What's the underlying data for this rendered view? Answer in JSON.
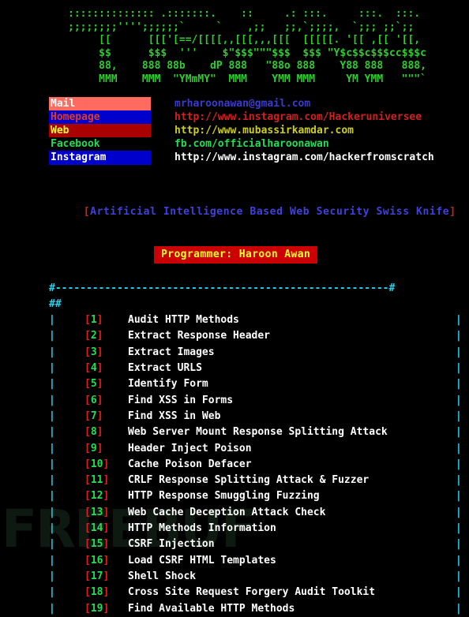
{
  "terminal": {
    "background": "#000000",
    "banner_color": "#2ecc2e",
    "border_color": "#22d3ee",
    "index_color": "#22dd55",
    "bracket_color": "#e02020"
  },
  "watermark": {
    "text": "FREEBUF"
  },
  "banner": {
    "lines": [
      ":::::::::::::: .:::::::.    ::     .: :::.     :::.  :::.",
      ";;;;;;;;'''';;;;;;`     `    ,;;   ;;,`;;;;,  `;;; ;;`;;",
      "     [[      [[['[==/[[[[,,[[[,,,[[[  [[[[[. '[[ ,[[ '[[,",
      "     $$      $$$  '''    $\"$$$\"\"\"$$$  $$$ \"Y$c$$c$$$cc$$$c",
      "     88,    888 88b    dP 888   \"88o 888    Y88 888   888,",
      "     MMM    MMM  \"YMmMY\"  MMM    YMM MMM     YM YMM   \"\"\"`"
    ]
  },
  "contacts": [
    {
      "label": "Mail",
      "value": "mrharoonawan@gmail.com",
      "label_bg": "#ff6b5e",
      "label_fg": "#ffffff",
      "value_fg": "#3a3ad0"
    },
    {
      "label": "Homepage",
      "value": "http://www.instagram.com/Hackeruniversee",
      "label_bg": "#0000cc",
      "label_fg": "#e03a2a",
      "value_fg": "#d02020"
    },
    {
      "label": "Web",
      "value": "http://www.mubassirkamdar.com",
      "label_bg": "#aa0000",
      "label_fg": "#ffff33",
      "value_fg": "#cccc22"
    },
    {
      "label": "Facebook",
      "value": "fb.com/officialharoonawan",
      "label_bg": "#000000",
      "label_fg": "#22dd55",
      "value_fg": "#22dd55"
    },
    {
      "label": "Instagram",
      "value": "http://www.instagram.com/hackerfromscratch",
      "label_bg": "#0000cc",
      "label_fg": "#ffffff",
      "value_fg": "#ffffff"
    }
  ],
  "tagline": {
    "open_bracket": "[",
    "text": "Artificial Intelligence Based Web Security Swiss Knife",
    "close_bracket": "]"
  },
  "programmer": {
    "text": "Programmer: Haroon Awan",
    "bg": "#cc0000",
    "fg": "#ffff33"
  },
  "menu": {
    "top_border": "#------------------------------------------------------#",
    "blank_border_left": "#",
    "blank_border_right": "#",
    "side_bar": "|",
    "items": [
      {
        "index": "1",
        "label": "Audit HTTP Methods"
      },
      {
        "index": "2",
        "label": "Extract Response Header"
      },
      {
        "index": "3",
        "label": "Extract Images"
      },
      {
        "index": "4",
        "label": "Extract URLS"
      },
      {
        "index": "5",
        "label": "Identify Form"
      },
      {
        "index": "6",
        "label": "Find XSS in Forms"
      },
      {
        "index": "7",
        "label": "Find XSS in Web"
      },
      {
        "index": "8",
        "label": "Web Server Mount Response Splitting Attack"
      },
      {
        "index": "9",
        "label": "Header Inject Poison"
      },
      {
        "index": "10",
        "label": "Cache Poison Defacer"
      },
      {
        "index": "11",
        "label": "CRLF Response Splitting Attack & Fuzzer"
      },
      {
        "index": "12",
        "label": "HTTP Response Smuggling Fuzzing"
      },
      {
        "index": "13",
        "label": "Web Cache Deception Attack Check"
      },
      {
        "index": "14",
        "label": "HTTP Methods Information"
      },
      {
        "index": "15",
        "label": "CSRF Injection"
      },
      {
        "index": "16",
        "label": "Load CSRF HTML Templates"
      },
      {
        "index": "17",
        "label": "Shell Shock"
      },
      {
        "index": "18",
        "label": "Cross Site Request Forgery Audit Toolkit"
      },
      {
        "index": "19",
        "label": "Find Available HTTP Methods"
      }
    ]
  }
}
